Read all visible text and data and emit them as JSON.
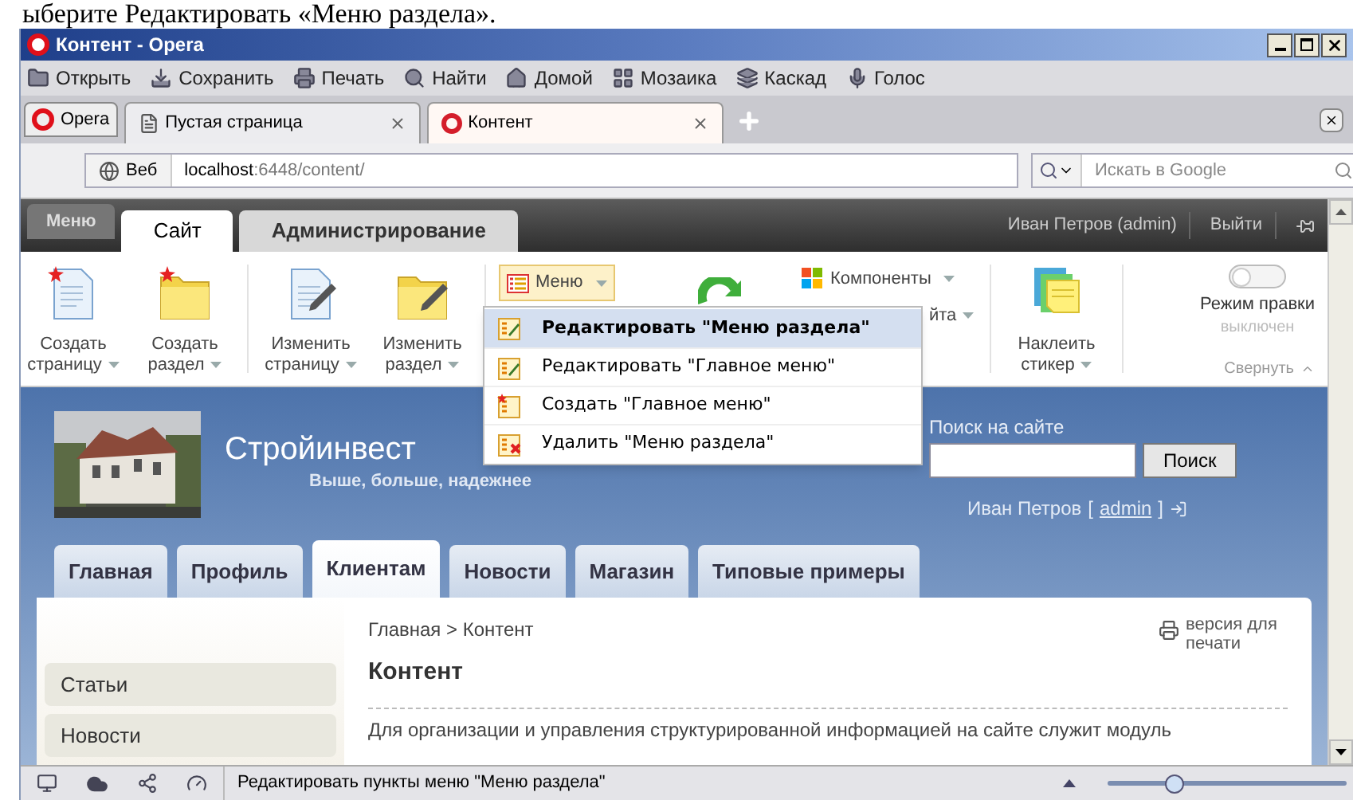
{
  "doc_caption": "ыберите Редактировать «Меню раздела».",
  "window": {
    "title": "Контент - Opera"
  },
  "browser_toolbar": [
    {
      "label": "Открыть",
      "kind": "open"
    },
    {
      "label": "Сохранить",
      "kind": "save"
    },
    {
      "label": "Печать",
      "kind": "print"
    },
    {
      "label": "Найти",
      "kind": "find"
    },
    {
      "label": "Домой",
      "kind": "home"
    },
    {
      "label": "Мозаика",
      "kind": "tile"
    },
    {
      "label": "Каскад",
      "kind": "cascade"
    },
    {
      "label": "Голос",
      "kind": "voice"
    }
  ],
  "browser_tabs": [
    {
      "label": "Opera",
      "kind": "menu",
      "selected": false
    },
    {
      "label": "Пустая страница",
      "kind": "page",
      "selected": false
    },
    {
      "label": "Контент",
      "kind": "page",
      "selected": true
    }
  ],
  "address_bar": {
    "site_label": "Веб",
    "host": "localhost",
    "path": ":6448/content/"
  },
  "search_field": {
    "placeholder": "Искать в Google"
  },
  "admin_panel": {
    "menu_label": "Меню",
    "tabs": [
      {
        "label": "Сайт",
        "selected": true
      },
      {
        "label": "Администрирование",
        "selected": false
      }
    ],
    "user": "Иван Петров (admin)",
    "logout": "Выйти"
  },
  "admin_toolbar": {
    "left_buttons": [
      {
        "line1": "Создать",
        "line2": "страницу",
        "kind": "new_page"
      },
      {
        "line1": "Создать",
        "line2": "раздел",
        "kind": "new_folder"
      },
      {
        "line1": "Изменить",
        "line2": "страницу",
        "kind": "edit_page"
      },
      {
        "line1": "Изменить",
        "line2": "раздел",
        "kind": "edit_folder"
      }
    ],
    "menu_button": {
      "label": "Меню",
      "open": true
    },
    "menu_items": [
      {
        "label": "Редактировать \"Меню раздела\"",
        "kind": "edit",
        "selected": true
      },
      {
        "label": "Редактировать \"Главное меню\"",
        "kind": "edit",
        "selected": false
      },
      {
        "label": "Создать \"Главное меню\"",
        "kind": "create",
        "selected": false
      },
      {
        "label": "Удалить \"Меню раздела\"",
        "kind": "delete",
        "selected": false
      }
    ],
    "partial_button": "йта",
    "components_button": "Компоненты",
    "sticker_button": {
      "line1": "Наклеить",
      "line2": "стикер"
    },
    "edit_mode": {
      "label": "Режим правки",
      "status": "выключен",
      "on": false
    },
    "collapse": "Свернуть"
  },
  "site": {
    "name": "Стройинвест",
    "tagline": "Выше, больше, надежнее",
    "search_label": "Поиск на сайте",
    "search_button": "Поиск",
    "user_name": "Иван Петров",
    "user_login": "admin",
    "login_brackets": [
      "[",
      "]"
    ],
    "nav": [
      {
        "label": "Главная",
        "selected": false
      },
      {
        "label": "Профиль",
        "selected": false
      },
      {
        "label": "Клиентам",
        "selected": true
      },
      {
        "label": "Новости",
        "selected": false
      },
      {
        "label": "Магазин",
        "selected": false
      },
      {
        "label": "Типовые примеры",
        "selected": false
      }
    ],
    "sidebar": [
      {
        "label": "Статьи"
      },
      {
        "label": "Новости"
      }
    ],
    "breadcrumb": "Главная > Контент",
    "print_link": "версия для печати",
    "heading": "Контент",
    "intro": "Для организации и управления структурированной информацией на сайте служит модуль"
  },
  "status_bar": {
    "text": "Редактировать пункты меню \"Меню раздела\"",
    "zoom": {
      "level": 0.28
    }
  }
}
